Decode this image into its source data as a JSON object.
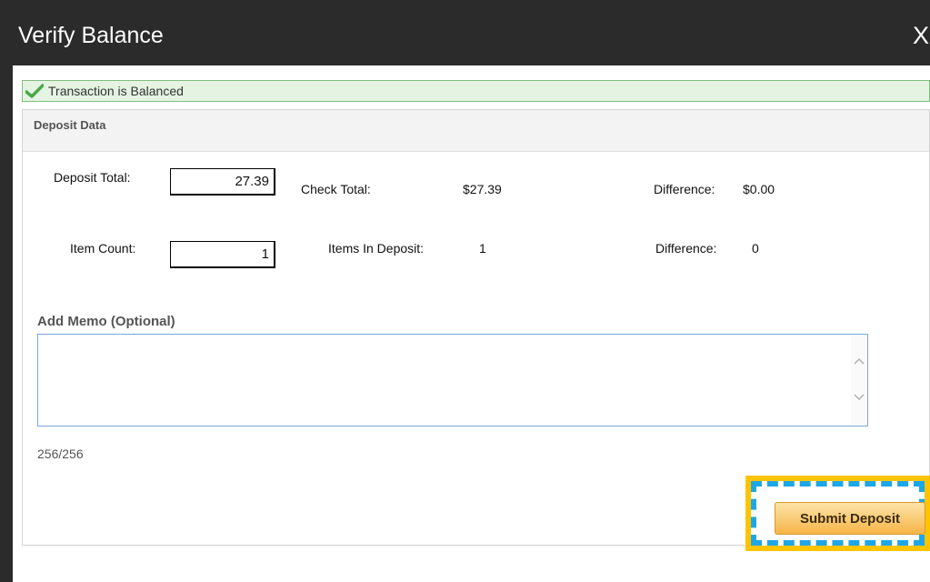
{
  "dialog": {
    "title": "Verify Balance",
    "close_label": "X"
  },
  "banner": {
    "text": "Transaction is Balanced",
    "icon": "checkmark-icon",
    "color": "#4aa84a"
  },
  "deposit_data": {
    "header": "Deposit Data",
    "deposit_total_label": "Deposit Total:",
    "deposit_total_value": "27.39",
    "check_total_label": "Check Total:",
    "check_total_value": "$27.39",
    "amount_difference_label": "Difference:",
    "amount_difference_value": "$0.00",
    "item_count_label": "Item Count:",
    "item_count_value": "1",
    "items_in_deposit_label": "Items In Deposit:",
    "items_in_deposit_value": "1",
    "count_difference_label": "Difference:",
    "count_difference_value": "0"
  },
  "memo": {
    "label": "Add Memo (Optional)",
    "value": "",
    "counter": "256/256"
  },
  "actions": {
    "submit_label": "Submit Deposit"
  }
}
